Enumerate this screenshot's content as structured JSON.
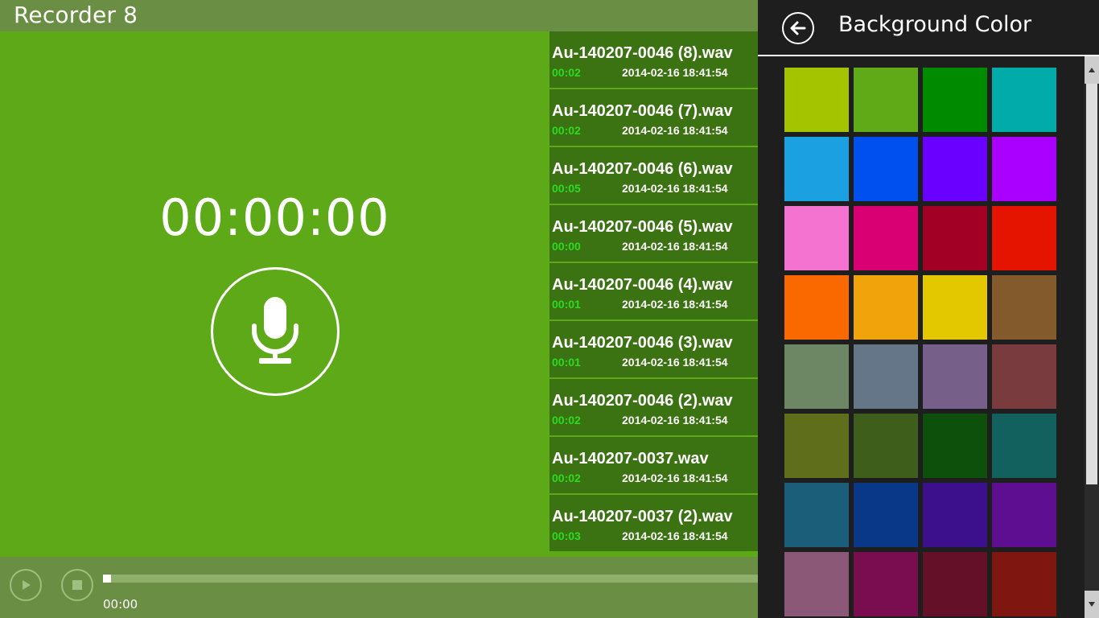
{
  "app": {
    "title": "Recorder 8"
  },
  "recorder": {
    "timer": "00:00:00",
    "icon": "microphone-icon"
  },
  "files": [
    {
      "name": "Au-140207-0046 (8).wav",
      "duration": "00:02",
      "date": "2014-02-16 18:41:54"
    },
    {
      "name": "Au-140207-0046 (7).wav",
      "duration": "00:02",
      "date": "2014-02-16 18:41:54"
    },
    {
      "name": "Au-140207-0046 (6).wav",
      "duration": "00:05",
      "date": "2014-02-16 18:41:54"
    },
    {
      "name": "Au-140207-0046 (5).wav",
      "duration": "00:00",
      "date": "2014-02-16 18:41:54"
    },
    {
      "name": "Au-140207-0046 (4).wav",
      "duration": "00:01",
      "date": "2014-02-16 18:41:54"
    },
    {
      "name": "Au-140207-0046 (3).wav",
      "duration": "00:01",
      "date": "2014-02-16 18:41:54"
    },
    {
      "name": "Au-140207-0046 (2).wav",
      "duration": "00:02",
      "date": "2014-02-16 18:41:54"
    },
    {
      "name": "Au-140207-0037.wav",
      "duration": "00:02",
      "date": "2014-02-16 18:41:54"
    },
    {
      "name": "Au-140207-0037 (2).wav",
      "duration": "00:03",
      "date": "2014-02-16 18:41:54"
    }
  ],
  "player": {
    "position": "00:00",
    "progress": 0,
    "play_icon": "play-icon",
    "stop_icon": "stop-icon"
  },
  "flyout": {
    "title": "Background Color",
    "back_icon": "back-arrow-icon",
    "swatches": [
      "#a4c400",
      "#60a917",
      "#008a00",
      "#00aba9",
      "#1ba1e2",
      "#0050ef",
      "#6a00ff",
      "#aa00ff",
      "#f472d0",
      "#d80073",
      "#a20025",
      "#e51400",
      "#fa6800",
      "#f0a30a",
      "#e3c800",
      "#825a2c",
      "#6d8764",
      "#647687",
      "#76608a",
      "#7a3b3f",
      "#5f6e1a",
      "#3e5f1b",
      "#0c500c",
      "#12615f",
      "#1b5e7a",
      "#0a3889",
      "#3c0f8c",
      "#5e0e91",
      "#8c5878",
      "#7a0d4f",
      "#631028",
      "#7f1610"
    ]
  },
  "colors": {
    "recorder_bg": "#5ea917",
    "app_bg": "#6a8e44",
    "list_item_bg": "#3c7312",
    "duration_text": "#2bdc1e",
    "flyout_bg": "#1e1e1e"
  }
}
